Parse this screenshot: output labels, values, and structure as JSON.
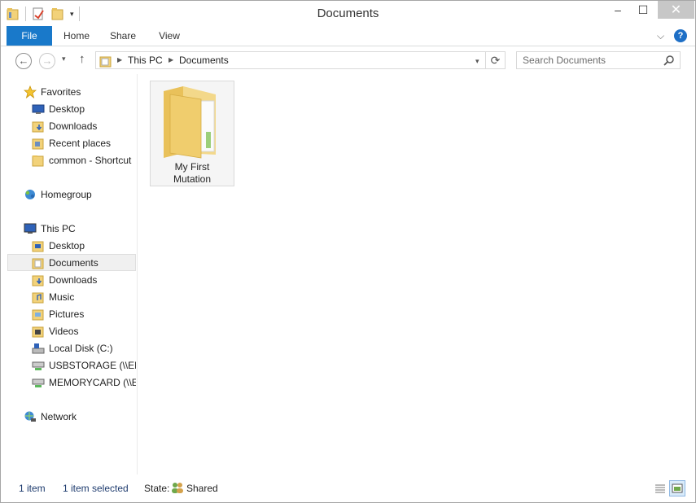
{
  "window": {
    "title": "Documents"
  },
  "title_controls": {
    "minimize": "–",
    "maximize": "☐",
    "close": "✕"
  },
  "ribbon": {
    "tabs": [
      "File",
      "Home",
      "Share",
      "View"
    ],
    "expand_chevron": "⌵",
    "help": "?"
  },
  "nav": {
    "back": "←",
    "forward": "→",
    "up": "↑",
    "breadcrumb": [
      "This PC",
      "Documents"
    ],
    "refresh": "⟳",
    "search_placeholder": "Search Documents"
  },
  "sidebar": {
    "favorites": {
      "label": "Favorites",
      "items": [
        "Desktop",
        "Downloads",
        "Recent places",
        "common - Shortcut"
      ]
    },
    "homegroup": {
      "label": "Homegroup"
    },
    "this_pc": {
      "label": "This PC",
      "items": [
        "Desktop",
        "Documents",
        "Downloads",
        "Music",
        "Pictures",
        "Videos",
        "Local Disk (C:)",
        "USBSTORAGE (\\\\EPS",
        "MEMORYCARD (\\\\EI"
      ],
      "selected": "Documents"
    },
    "network": {
      "label": "Network"
    }
  },
  "content": {
    "items": [
      {
        "name_line1": "My First",
        "name_line2": "Mutation"
      }
    ]
  },
  "status": {
    "item_count": "1 item",
    "selected": "1 item selected",
    "state_label": "State:",
    "state_value": "Shared"
  },
  "colors": {
    "accent": "#1979ca",
    "folder": "#f2d27a",
    "selection": "#f0f0f0"
  }
}
